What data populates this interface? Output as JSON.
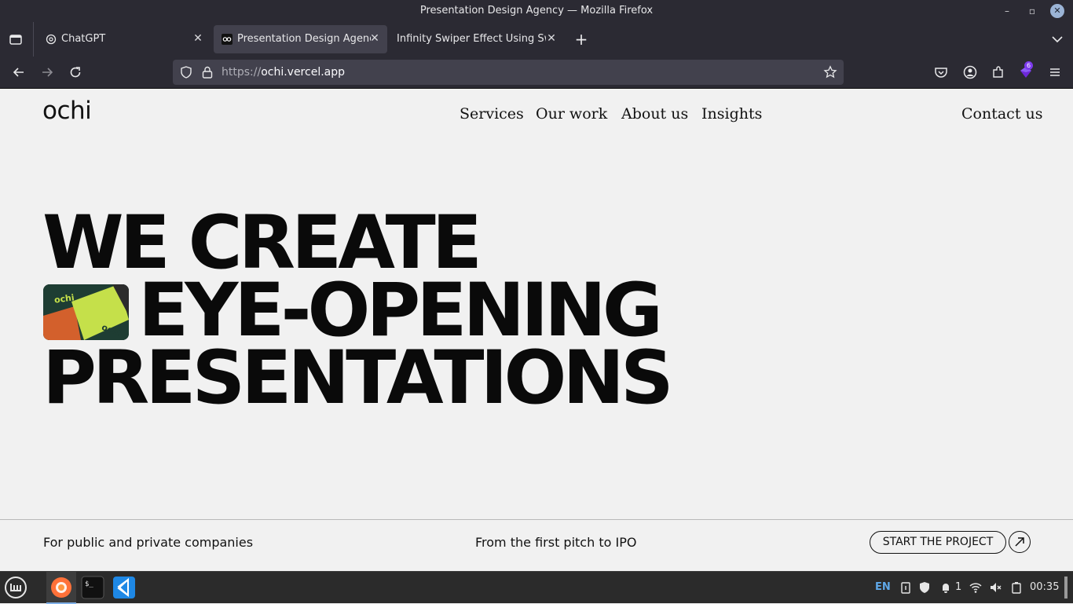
{
  "window": {
    "title": "Presentation Design Agency — Mozilla Firefox"
  },
  "tabs": [
    {
      "label": "ChatGPT"
    },
    {
      "label": "Presentation Design Agency"
    },
    {
      "label": "Infinity Swiper Effect Using Swip"
    }
  ],
  "url": {
    "scheme": "https://",
    "host": "ochi.vercel.app"
  },
  "extensions": {
    "badge_count": "6"
  },
  "site": {
    "logo": "ochi",
    "nav": [
      "Services",
      "Our work",
      "About us",
      "Insights"
    ],
    "contact": "Contact us",
    "hero_lines": [
      "WE CREATE",
      "EYE-OPENING",
      "PRESENTATIONS"
    ],
    "hero_image_text": "ochi",
    "footer": {
      "left": "For public and private companies",
      "center": "From the first pitch to IPO",
      "cta": "START THE PROJECT"
    }
  },
  "taskbar": {
    "lang": "EN",
    "notifications": "1",
    "clock": "00:35"
  },
  "colors": {
    "accent_green": "#c5e04a",
    "hero_bg": "#1e3d33",
    "ext_badge": "#7c3aed"
  }
}
